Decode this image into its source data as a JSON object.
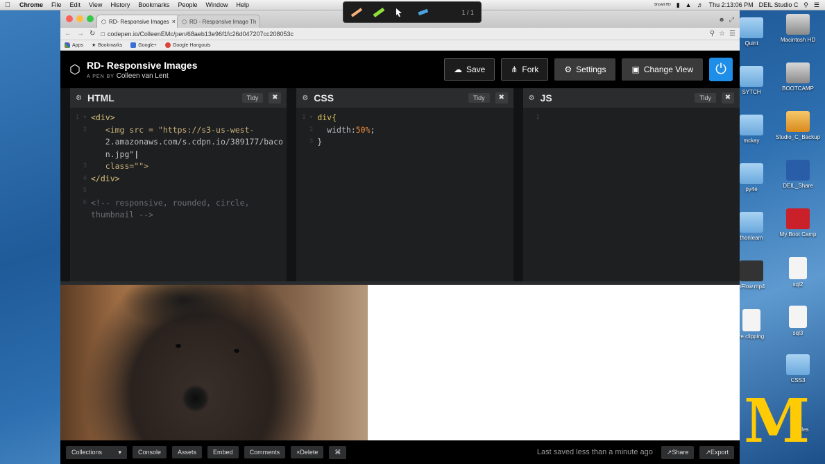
{
  "menubar": {
    "app": "Chrome",
    "menus": [
      "File",
      "Edit",
      "View",
      "History",
      "Bookmarks",
      "People",
      "Window",
      "Help"
    ],
    "status_small": "ShowIt HD",
    "clock": "Thu 2:13:06 PM",
    "user": "DEIL Studio C"
  },
  "annotation_toolbar": {
    "count": "1 / 1"
  },
  "browser": {
    "tabs": [
      {
        "label": "RD- Responsive Images"
      },
      {
        "label": "RD - Responsive Image Th"
      }
    ],
    "url": "codepen.io/ColleenEMc/pen/68aeb13e96f1fc26d047207cc208053c",
    "bookmarks": [
      "Apps",
      "Bookmarks",
      "Google+",
      "Google Hangouts"
    ]
  },
  "pen": {
    "title": "RD- Responsive Images",
    "by_prefix": "A PEN BY",
    "author": "Colleen van Lent",
    "buttons": {
      "save": "Save",
      "fork": "Fork",
      "settings": "Settings",
      "change_view": "Change View"
    }
  },
  "editors": {
    "html": {
      "lang": "HTML",
      "tidy": "Tidy",
      "lines": {
        "l1": "<div>",
        "l2a": "<img src = \"https://s3-us-west-",
        "l2b": "2.amazonaws.com/s.cdpn.io/389177/baco",
        "l2c": "n.jpg\"",
        "l3": "class=\"\">",
        "l4": "</div>",
        "l6a": "<!-- responsive, rounded, circle,",
        "l6b": "thumbnail -->"
      }
    },
    "css": {
      "lang": "CSS",
      "tidy": "Tidy",
      "lines": {
        "l1": "div{",
        "prop": "width",
        "value": "50%",
        "close": "}"
      }
    },
    "js": {
      "lang": "JS",
      "tidy": "Tidy"
    }
  },
  "footer": {
    "collections": "Collections",
    "console": "Console",
    "assets": "Assets",
    "embed": "Embed",
    "comments": "Comments",
    "delete": "Delete",
    "shortcut": "⌘",
    "saved": "Last saved less than a minute ago",
    "share": "Share",
    "export": "Export"
  },
  "desktop": {
    "icons": [
      "Quint",
      "Macintosh HD",
      "SYTCH",
      "BOOTCAMP",
      "mckay",
      "Studio_C_Backup",
      "py4e",
      "DEIL_Share",
      "thonlearn",
      "My Boot Camp",
      "nFlow.mp4",
      "sql2",
      "re clipping",
      "sql3",
      "CSS3",
      "Files"
    ]
  }
}
